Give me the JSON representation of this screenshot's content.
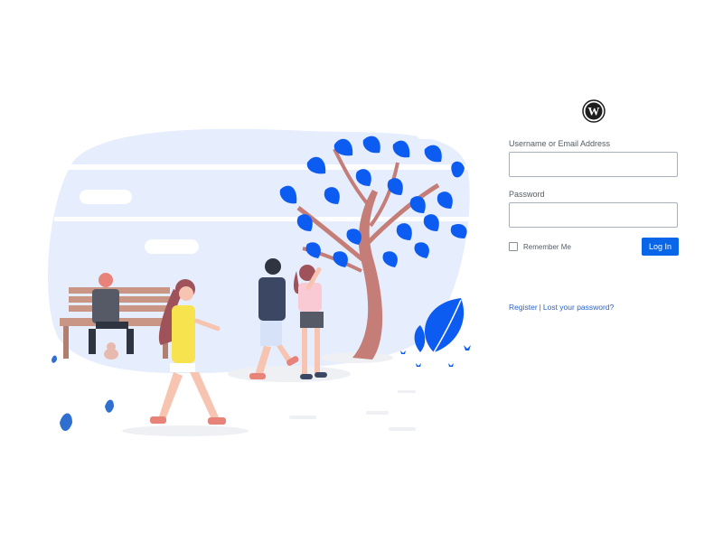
{
  "login": {
    "logo_icon": "wordpress-logo-icon",
    "username_label": "Username or Email Address",
    "username_value": "",
    "password_label": "Password",
    "password_value": "",
    "remember_label": "Remember Me",
    "remember_checked": false,
    "login_button": "Log In",
    "register_link": "Register",
    "separator": "|",
    "lost_password_link": "Lost your password?"
  },
  "illustration": {
    "icon": "park-scene-illustration",
    "accent_color": "#0d5cf2",
    "background_blob_color": "#e6edfc"
  },
  "colors": {
    "button": "#0a66e8",
    "link": "#2a62c9",
    "label_text": "#555b63"
  }
}
